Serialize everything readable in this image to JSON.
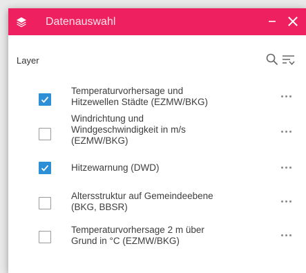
{
  "window": {
    "title": "Datenauswahl",
    "title_icon": "layers-icon",
    "minimize_icon": "minimize-icon",
    "close_icon": "close-icon",
    "accent_color": "#ef2060"
  },
  "layer_header": {
    "label": "Layer",
    "search_icon": "search-icon",
    "filter_icon": "filter-list-icon"
  },
  "layers": [
    {
      "label": "Temperaturvorhersage und\nHitzewellen Städte (EZMW/BKG)",
      "checked": true
    },
    {
      "label": "Windrichtung und\nWindgeschwindigkeit in m/s\n(EZMW/BKG)",
      "checked": false
    },
    {
      "label": "Hitzewarnung (DWD)",
      "checked": true
    },
    {
      "label": "Altersstruktur auf Gemeindeebene\n(BKG, BBSR)",
      "checked": false
    },
    {
      "label": "Temperaturvorhersage 2 m über\nGrund in °C (EZMW/BKG)",
      "checked": false
    }
  ],
  "checkbox_checked_color": "#2d8fd6",
  "more_icon": "more-horizontal-icon"
}
